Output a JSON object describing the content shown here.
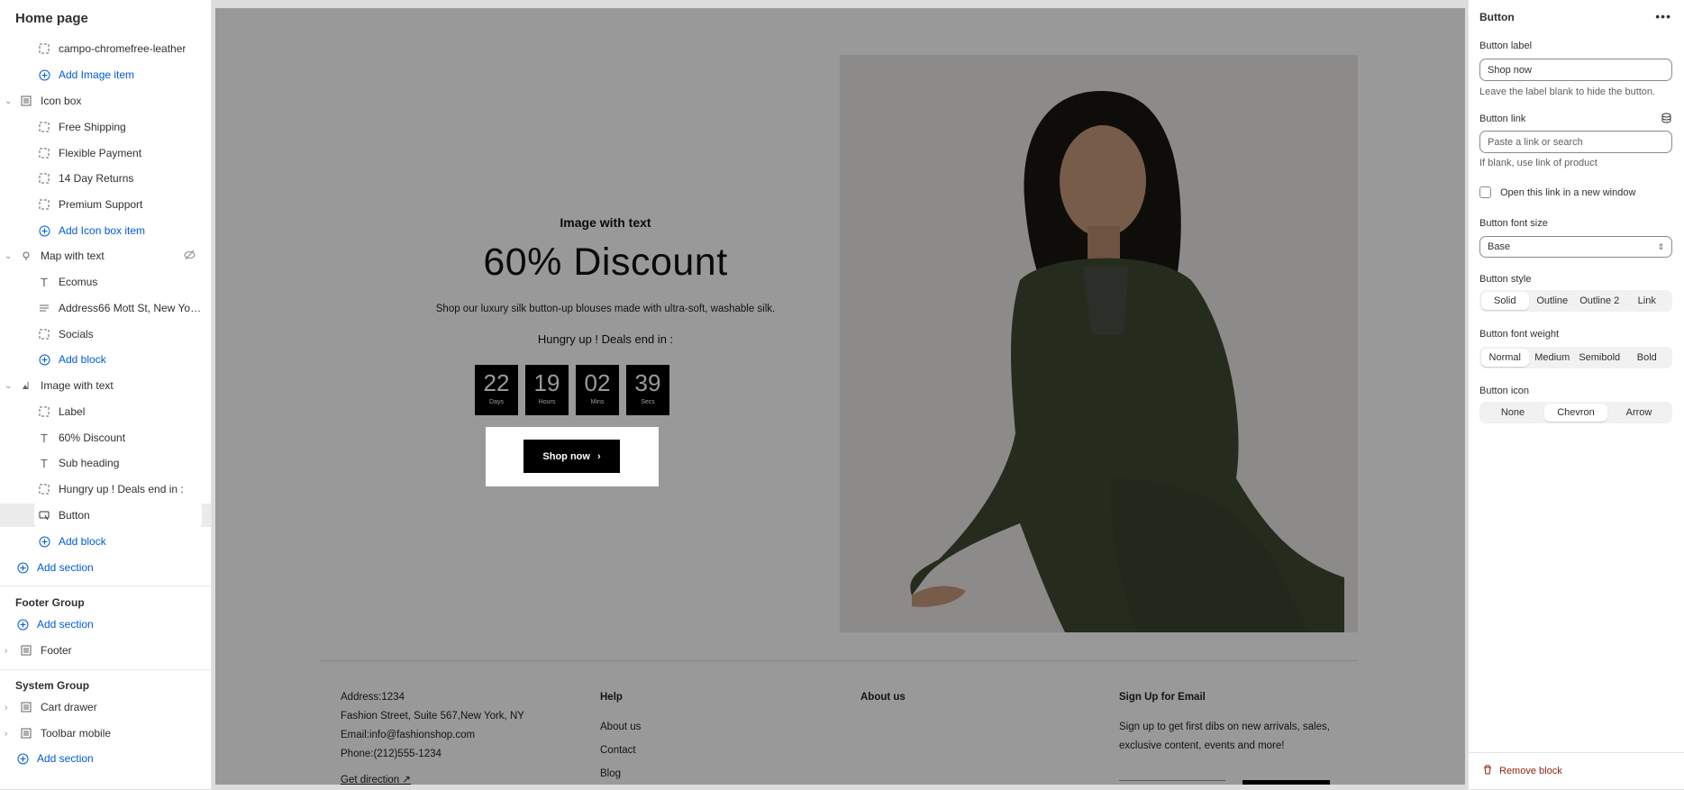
{
  "sidebar": {
    "title": "Home page",
    "image_group": {
      "items": [
        {
          "label": "campo-chromefree-leather"
        }
      ],
      "add_label": "Add Image item"
    },
    "icon_box": {
      "label": "Icon box",
      "items": [
        "Free Shipping",
        "Flexible Payment",
        "14 Day Returns",
        "Premium Support"
      ],
      "add_label": "Add Icon box item"
    },
    "map_with_text": {
      "label": "Map with text",
      "items": [
        "Ecomus",
        "Address66 Mott St, New York,...",
        "Socials"
      ],
      "add_label": "Add block"
    },
    "image_with_text": {
      "label": "Image with text",
      "items": [
        "Label",
        "60% Discount",
        "Sub heading",
        "Hungry up ! Deals end in :",
        "Button"
      ],
      "add_label": "Add block"
    },
    "add_section": "Add section",
    "footer_group": {
      "title": "Footer Group",
      "add_section": "Add section",
      "items": [
        "Footer"
      ]
    },
    "system_group": {
      "title": "System Group",
      "items": [
        "Cart drawer",
        "Toolbar mobile"
      ],
      "add_section": "Add section"
    }
  },
  "preview": {
    "label": "Image with text",
    "heading": "60% Discount",
    "subheading": "Shop our luxury silk button-up blouses made with ultra-soft, washable silk.",
    "hungry_text": "Hungry up ! Deals end in :",
    "countdown": [
      {
        "value": "22",
        "unit": "Days"
      },
      {
        "value": "19",
        "unit": "Hours"
      },
      {
        "value": "02",
        "unit": "Mins"
      },
      {
        "value": "39",
        "unit": "Secs"
      }
    ],
    "button_label": "Shop now",
    "footer": {
      "address_lines": [
        "Address:1234",
        "Fashion Street, Suite 567,New York, NY",
        "Email:info@fashionshop.com",
        "Phone:(212)555-1234"
      ],
      "get_direction": "Get direction",
      "help_title": "Help",
      "help_links": [
        "About us",
        "Contact",
        "Blog"
      ],
      "about_title": "About us",
      "signup_title": "Sign Up for Email",
      "signup_text": "Sign up to get first dibs on new arrivals, sales, exclusive content, events and more!"
    }
  },
  "panel": {
    "title": "Button",
    "button_label": {
      "label": "Button label",
      "value": "Shop now",
      "help": "Leave the label blank to hide the button."
    },
    "button_link": {
      "label": "Button link",
      "placeholder": "Paste a link or search",
      "help": "If blank, use link of product"
    },
    "new_window_label": "Open this link in a new window",
    "font_size": {
      "label": "Button font size",
      "value": "Base"
    },
    "style": {
      "label": "Button style",
      "options": [
        "Solid",
        "Outline",
        "Outline 2",
        "Link"
      ],
      "selected": "Solid"
    },
    "font_weight": {
      "label": "Button font weight",
      "options": [
        "Normal",
        "Medium",
        "Semibold",
        "Bold"
      ],
      "selected": "Normal"
    },
    "icon": {
      "label": "Button icon",
      "options": [
        "None",
        "Chevron",
        "Arrow"
      ],
      "selected": "Chevron"
    },
    "remove_label": "Remove block"
  },
  "colors": {
    "link_blue": "#005bd3",
    "danger": "#8e1f0b",
    "overlay": "rgba(0,0,0,0.40)"
  }
}
